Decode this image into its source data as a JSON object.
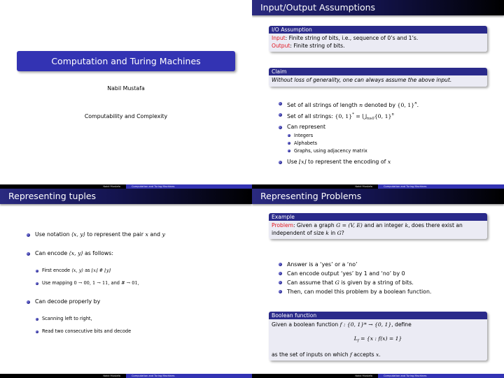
{
  "footer": {
    "author": "Nabil Mustafa",
    "title": "Computation and Turing Machines"
  },
  "colors": {
    "structure": "#3333b3",
    "alert": "#e0151f",
    "block_body": "#ebebf4"
  },
  "slide1": {
    "title": "Computation and Turing Machines",
    "author": "Nabil Mustafa",
    "institute": "Computability and Complexity"
  },
  "slide2": {
    "frametitle": "Input/Output Assumptions",
    "block1": {
      "title": "I/O Assumption",
      "line1_label": "Input",
      "line1_text": ": Finite string of bits, i.e., sequence of 0’s and 1’s.",
      "line2_label": "Output",
      "line2_text": ": Finite string of bits."
    },
    "block2": {
      "title": "Claim",
      "text": "Without loss of generality, one can always assume the above input."
    },
    "bullets": [
      {
        "text_a": "Set of all strings of length ",
        "var": "n",
        "text_b": " denoted by ",
        "math": "{0, 1}",
        "sup": "n",
        "tail": "."
      },
      {
        "text_a": "Set of all strings: ",
        "math": "{0, 1}",
        "sup": "*",
        "math2": " = ⋃",
        "sub": "n≥0",
        "math3": "{0, 1}",
        "sup2": "n"
      },
      {
        "text_a": "Can represent",
        "sub_items": [
          "Integers",
          "Alphabets",
          "Graphs, using adjacency matrix"
        ]
      },
      {
        "text_a": "Use ",
        "math": "⌊x⌋",
        "text_b": " to represent the encoding of ",
        "var": "x"
      }
    ]
  },
  "slide3": {
    "frametitle": "Representing tuples",
    "bullets": [
      {
        "text_a": "Use notation ",
        "math": "⟨x, y⟩",
        "text_b": " to represent the pair ",
        "var1": "x",
        "text_c": " and ",
        "var2": "y"
      },
      {
        "text_a": "Can encode ",
        "math": "⟨x, y⟩",
        "text_b": " as follows:",
        "sub_items": [
          {
            "text_a": "First encode ",
            "math": "⟨x, y⟩",
            "text_b": " as ",
            "math2": "⌊x⌋ # ⌊y⌋"
          },
          {
            "text_a": "Use mapping ",
            "math": "0 → 00, 1 → 11,",
            "text_b": " and ",
            "math2": "# → 01,"
          }
        ]
      },
      {
        "text_a": "Can decode properly by",
        "sub_items": [
          "Scanning left to right,",
          "Read two consecutive bits and decode"
        ]
      }
    ]
  },
  "slide4": {
    "frametitle": "Representing Problems",
    "example_block": {
      "title": "Example",
      "label": "Problem",
      "text_a": ": Given a graph ",
      "math1": "G = (V, E)",
      "text_b": " and an integer ",
      "var_k": "k",
      "text_c": ", does there exist an independent of size ",
      "var_k2": "k",
      "text_d": " in ",
      "var_g": "G",
      "text_e": "?"
    },
    "bullets": [
      "Answer is a ‘yes’ or a ‘no’",
      "Can encode output ‘yes’ by 1 and ‘no’ by 0",
      {
        "text_a": "Can assume that ",
        "var": "G",
        "text_b": " is given by a string of bits."
      },
      "Then, can model this problem by a boolean function."
    ],
    "boolean_block": {
      "title": "Boolean function",
      "line1_a": "Given a boolean function ",
      "line1_math": "f : {0, 1}* → {0, 1}",
      "line1_b": ", define",
      "equation_lhs": "L",
      "equation_sub": "f",
      "equation_rhs": " = {x : f(x) = 1}",
      "line3_a": "as the set of inputs on which ",
      "line3_var_f": "f",
      "line3_b": " accepts ",
      "line3_var_x": "x",
      "line3_c": "."
    }
  }
}
